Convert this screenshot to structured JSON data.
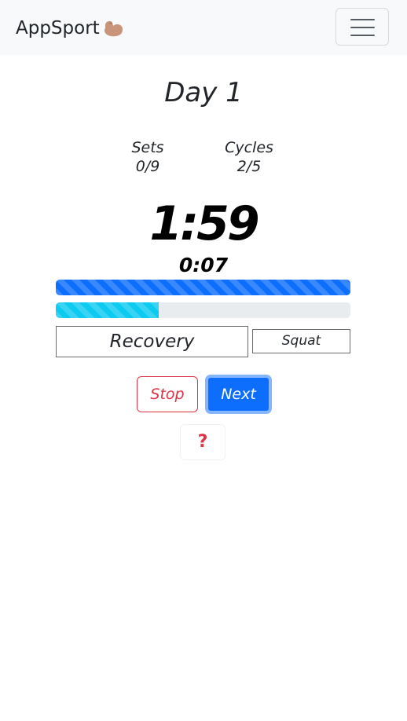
{
  "navbar": {
    "brand": "AppSport",
    "brand_icon": "flexed-biceps-icon",
    "menu_icon": "hamburger-menu-icon"
  },
  "workout": {
    "title": "Day 1",
    "sets_label": "Sets",
    "sets_value": "0/9",
    "cycles_label": "Cycles",
    "cycles_value": "2/5",
    "timer_main": "1:59",
    "timer_sub": "0:07",
    "progress_primary": 1.0,
    "progress_secondary": 0.35,
    "phase": "Recovery",
    "exercise": "Squat"
  },
  "actions": {
    "stop_label": "Stop",
    "next_label": "Next",
    "help_label": "?"
  },
  "colors": {
    "primary": "#0d6efd",
    "info": "#0dcaf0",
    "danger": "#dc3545",
    "navbar_bg": "#f8f9fa"
  }
}
